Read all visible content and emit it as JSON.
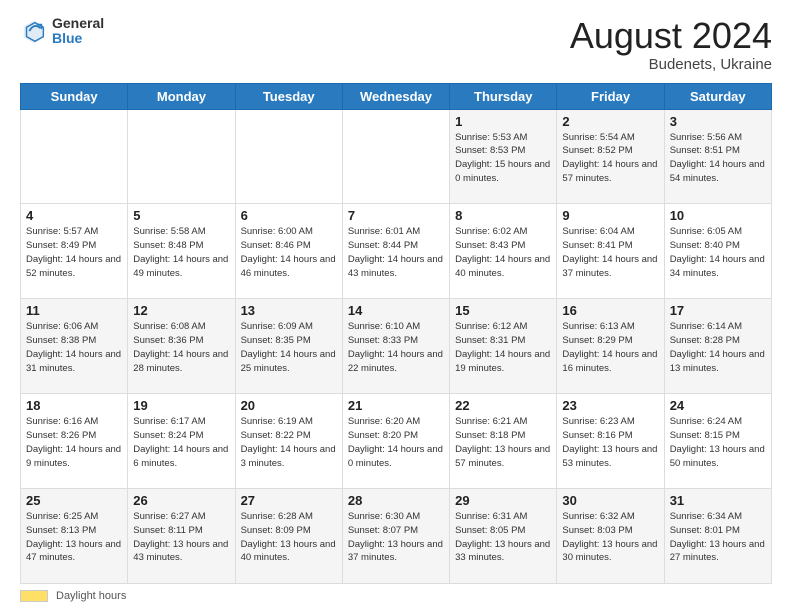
{
  "header": {
    "logo_general": "General",
    "logo_blue": "Blue",
    "month_title": "August 2024",
    "location": "Budenets, Ukraine"
  },
  "days_of_week": [
    "Sunday",
    "Monday",
    "Tuesday",
    "Wednesday",
    "Thursday",
    "Friday",
    "Saturday"
  ],
  "footer": {
    "legend_label": "Daylight hours"
  },
  "weeks": [
    [
      {
        "day": "",
        "info": ""
      },
      {
        "day": "",
        "info": ""
      },
      {
        "day": "",
        "info": ""
      },
      {
        "day": "",
        "info": ""
      },
      {
        "day": "1",
        "info": "Sunrise: 5:53 AM\nSunset: 8:53 PM\nDaylight: 15 hours\nand 0 minutes."
      },
      {
        "day": "2",
        "info": "Sunrise: 5:54 AM\nSunset: 8:52 PM\nDaylight: 14 hours\nand 57 minutes."
      },
      {
        "day": "3",
        "info": "Sunrise: 5:56 AM\nSunset: 8:51 PM\nDaylight: 14 hours\nand 54 minutes."
      }
    ],
    [
      {
        "day": "4",
        "info": "Sunrise: 5:57 AM\nSunset: 8:49 PM\nDaylight: 14 hours\nand 52 minutes."
      },
      {
        "day": "5",
        "info": "Sunrise: 5:58 AM\nSunset: 8:48 PM\nDaylight: 14 hours\nand 49 minutes."
      },
      {
        "day": "6",
        "info": "Sunrise: 6:00 AM\nSunset: 8:46 PM\nDaylight: 14 hours\nand 46 minutes."
      },
      {
        "day": "7",
        "info": "Sunrise: 6:01 AM\nSunset: 8:44 PM\nDaylight: 14 hours\nand 43 minutes."
      },
      {
        "day": "8",
        "info": "Sunrise: 6:02 AM\nSunset: 8:43 PM\nDaylight: 14 hours\nand 40 minutes."
      },
      {
        "day": "9",
        "info": "Sunrise: 6:04 AM\nSunset: 8:41 PM\nDaylight: 14 hours\nand 37 minutes."
      },
      {
        "day": "10",
        "info": "Sunrise: 6:05 AM\nSunset: 8:40 PM\nDaylight: 14 hours\nand 34 minutes."
      }
    ],
    [
      {
        "day": "11",
        "info": "Sunrise: 6:06 AM\nSunset: 8:38 PM\nDaylight: 14 hours\nand 31 minutes."
      },
      {
        "day": "12",
        "info": "Sunrise: 6:08 AM\nSunset: 8:36 PM\nDaylight: 14 hours\nand 28 minutes."
      },
      {
        "day": "13",
        "info": "Sunrise: 6:09 AM\nSunset: 8:35 PM\nDaylight: 14 hours\nand 25 minutes."
      },
      {
        "day": "14",
        "info": "Sunrise: 6:10 AM\nSunset: 8:33 PM\nDaylight: 14 hours\nand 22 minutes."
      },
      {
        "day": "15",
        "info": "Sunrise: 6:12 AM\nSunset: 8:31 PM\nDaylight: 14 hours\nand 19 minutes."
      },
      {
        "day": "16",
        "info": "Sunrise: 6:13 AM\nSunset: 8:29 PM\nDaylight: 14 hours\nand 16 minutes."
      },
      {
        "day": "17",
        "info": "Sunrise: 6:14 AM\nSunset: 8:28 PM\nDaylight: 14 hours\nand 13 minutes."
      }
    ],
    [
      {
        "day": "18",
        "info": "Sunrise: 6:16 AM\nSunset: 8:26 PM\nDaylight: 14 hours\nand 9 minutes."
      },
      {
        "day": "19",
        "info": "Sunrise: 6:17 AM\nSunset: 8:24 PM\nDaylight: 14 hours\nand 6 minutes."
      },
      {
        "day": "20",
        "info": "Sunrise: 6:19 AM\nSunset: 8:22 PM\nDaylight: 14 hours\nand 3 minutes."
      },
      {
        "day": "21",
        "info": "Sunrise: 6:20 AM\nSunset: 8:20 PM\nDaylight: 14 hours\nand 0 minutes."
      },
      {
        "day": "22",
        "info": "Sunrise: 6:21 AM\nSunset: 8:18 PM\nDaylight: 13 hours\nand 57 minutes."
      },
      {
        "day": "23",
        "info": "Sunrise: 6:23 AM\nSunset: 8:16 PM\nDaylight: 13 hours\nand 53 minutes."
      },
      {
        "day": "24",
        "info": "Sunrise: 6:24 AM\nSunset: 8:15 PM\nDaylight: 13 hours\nand 50 minutes."
      }
    ],
    [
      {
        "day": "25",
        "info": "Sunrise: 6:25 AM\nSunset: 8:13 PM\nDaylight: 13 hours\nand 47 minutes."
      },
      {
        "day": "26",
        "info": "Sunrise: 6:27 AM\nSunset: 8:11 PM\nDaylight: 13 hours\nand 43 minutes."
      },
      {
        "day": "27",
        "info": "Sunrise: 6:28 AM\nSunset: 8:09 PM\nDaylight: 13 hours\nand 40 minutes."
      },
      {
        "day": "28",
        "info": "Sunrise: 6:30 AM\nSunset: 8:07 PM\nDaylight: 13 hours\nand 37 minutes."
      },
      {
        "day": "29",
        "info": "Sunrise: 6:31 AM\nSunset: 8:05 PM\nDaylight: 13 hours\nand 33 minutes."
      },
      {
        "day": "30",
        "info": "Sunrise: 6:32 AM\nSunset: 8:03 PM\nDaylight: 13 hours\nand 30 minutes."
      },
      {
        "day": "31",
        "info": "Sunrise: 6:34 AM\nSunset: 8:01 PM\nDaylight: 13 hours\nand 27 minutes."
      }
    ]
  ]
}
